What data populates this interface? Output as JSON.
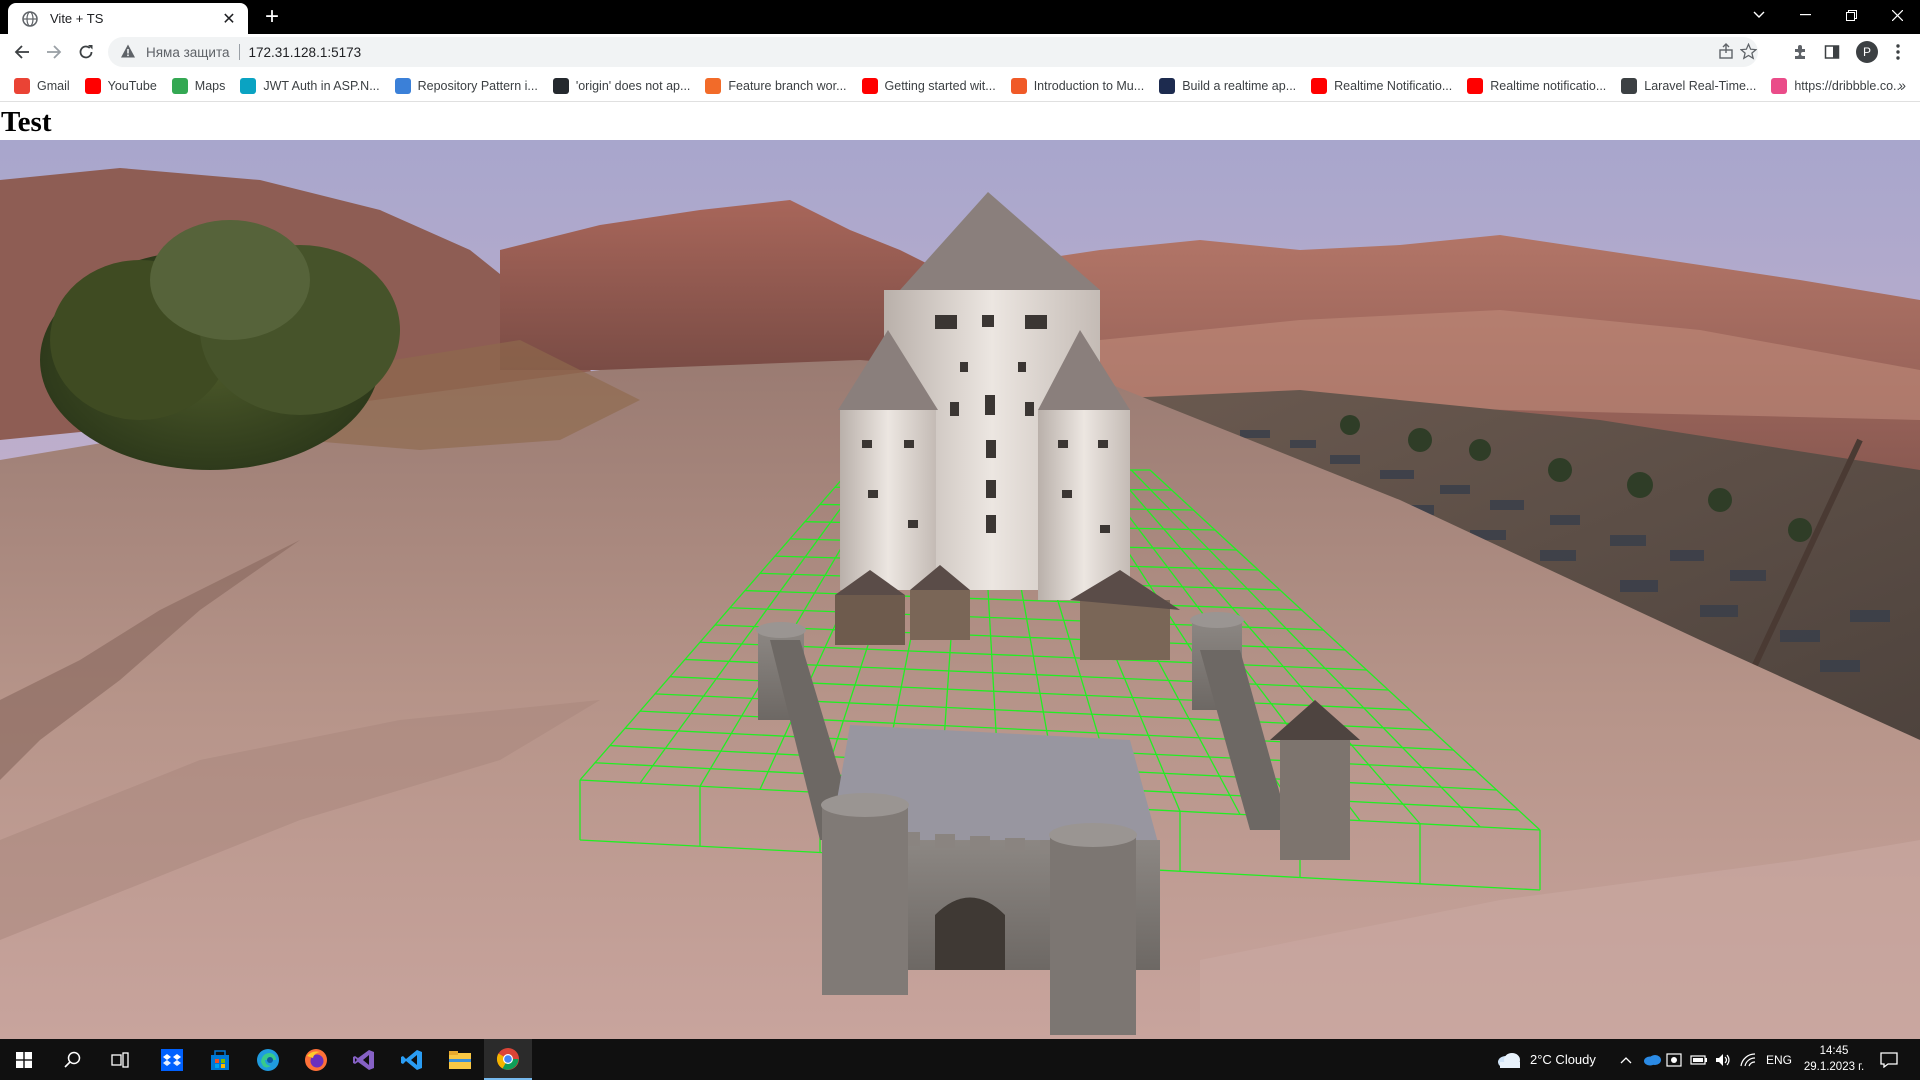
{
  "browser": {
    "tab_title": "Vite + TS",
    "security_label": "Няма защита",
    "url": "172.31.128.1:5173",
    "profile_initial": "P"
  },
  "bookmarks": [
    {
      "label": "Gmail",
      "icon": "gmail-icon",
      "color": "#ea4335"
    },
    {
      "label": "YouTube",
      "icon": "youtube-icon",
      "color": "#ff0000"
    },
    {
      "label": "Maps",
      "icon": "maps-icon",
      "color": "#34a853"
    },
    {
      "label": "JWT Auth in ASP.N...",
      "icon": "jwt-icon",
      "color": "#0aa3c2"
    },
    {
      "label": "Repository Pattern i...",
      "icon": "visualstudio-icon",
      "color": "#3b80d8"
    },
    {
      "label": "'origin' does not ap...",
      "icon": "github-icon",
      "color": "#24292e"
    },
    {
      "label": "Feature branch wor...",
      "icon": "atlassian-icon",
      "color": "#f26b29"
    },
    {
      "label": "Getting started wit...",
      "icon": "youtube-icon",
      "color": "#ff0000"
    },
    {
      "label": "Introduction to Mu...",
      "icon": "a-icon",
      "color": "#f05a28"
    },
    {
      "label": "Build a realtime ap...",
      "icon": "site-icon",
      "color": "#1d2b4f"
    },
    {
      "label": "Realtime Notificatio...",
      "icon": "youtube-icon",
      "color": "#ff0000"
    },
    {
      "label": "Realtime notificatio...",
      "icon": "youtube-icon",
      "color": "#ff0000"
    },
    {
      "label": "Laravel Real-Time...",
      "icon": "tensor-icon",
      "color": "#3c4043"
    },
    {
      "label": "https://dribbble.co...",
      "icon": "dribbble-icon",
      "color": "#ea4c89"
    }
  ],
  "page": {
    "heading": "Test"
  },
  "scene": {
    "wireframe_color": "#22ee22",
    "sky_top": "#a4a3c8",
    "sky_bottom": "#d9b3c3"
  },
  "taskbar": {
    "weather": "2°C  Cloudy",
    "language": "ENG",
    "time": "14:45",
    "date": "29.1.2023 г."
  }
}
